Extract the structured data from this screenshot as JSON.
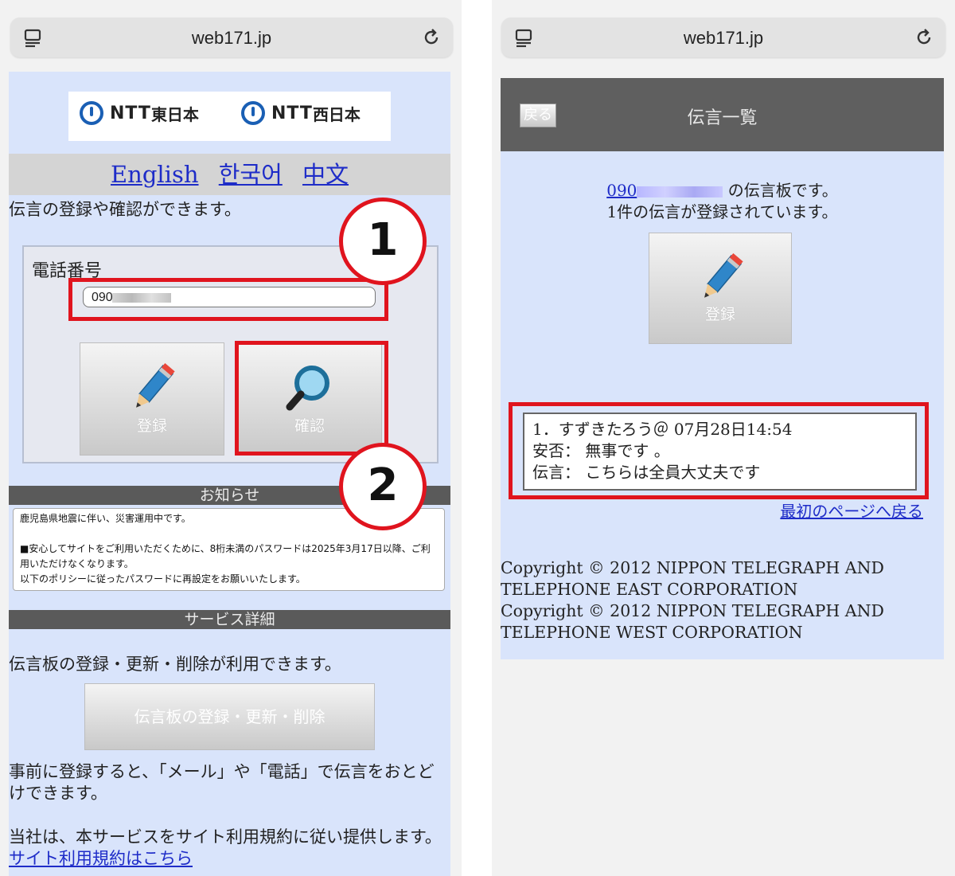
{
  "left": {
    "url": "web171.jp",
    "logos": [
      {
        "ntt": "NTT",
        "region": "東日本"
      },
      {
        "ntt": "NTT",
        "region": "西日本"
      }
    ],
    "languages": [
      "English",
      "한국어",
      "中文"
    ],
    "intro": "伝言の登録や確認ができます。",
    "phone_label": "電話番号",
    "phone_value": "090",
    "register_button": "登録",
    "confirm_button": "確認",
    "markers": [
      "1",
      "2"
    ],
    "notice_heading": "お知らせ",
    "notice_lines": [
      "鹿児島県地震に伴い、災害運用中です。",
      "■安心してサイトをご利用いただくために、8桁未満のパスワードは2025年3月17日以降、ご利用いただけなくなります。",
      "以下のポリシーに従ったパスワードに再設定をお願いいたします。"
    ],
    "service_heading": "サービス詳細",
    "service_text": "伝言板の登録・更新・削除が利用できます。",
    "service_button": "伝言板の登録・更新・削除",
    "prereg_text": "事前に登録すると、「メール」や「電話」で伝言をおとどけできます。",
    "terms_text": "当社は、本サービスをサイト利用規約に従い提供します。",
    "terms_link": "サイト利用規約はこちら"
  },
  "right": {
    "url": "web171.jp",
    "back_button": "戻る",
    "title": "伝言一覧",
    "board_number": "090",
    "board_suffix": "の伝言板です。",
    "count_text": "1件の伝言が登録されています。",
    "register_button": "登録",
    "message": {
      "header": "1．すずきたろう＠ 07月28日14:54",
      "safety": "安否： 無事です 。",
      "content": "伝言： こちらは全員大丈夫です"
    },
    "first_page_link": "最初のページへ戻る",
    "copyright_lines": [
      "Copyright © 2012 NIPPON TELEGRAPH AND TELEPHONE EAST CORPORATION",
      "Copyright © 2012 NIPPON TELEGRAPH AND TELEPHONE WEST CORPORATION"
    ]
  },
  "colors": {
    "highlight": "#e0141e",
    "page_bg": "#d9e4fb",
    "link": "#1e2cc8",
    "header_bg": "#5f5f5f"
  }
}
